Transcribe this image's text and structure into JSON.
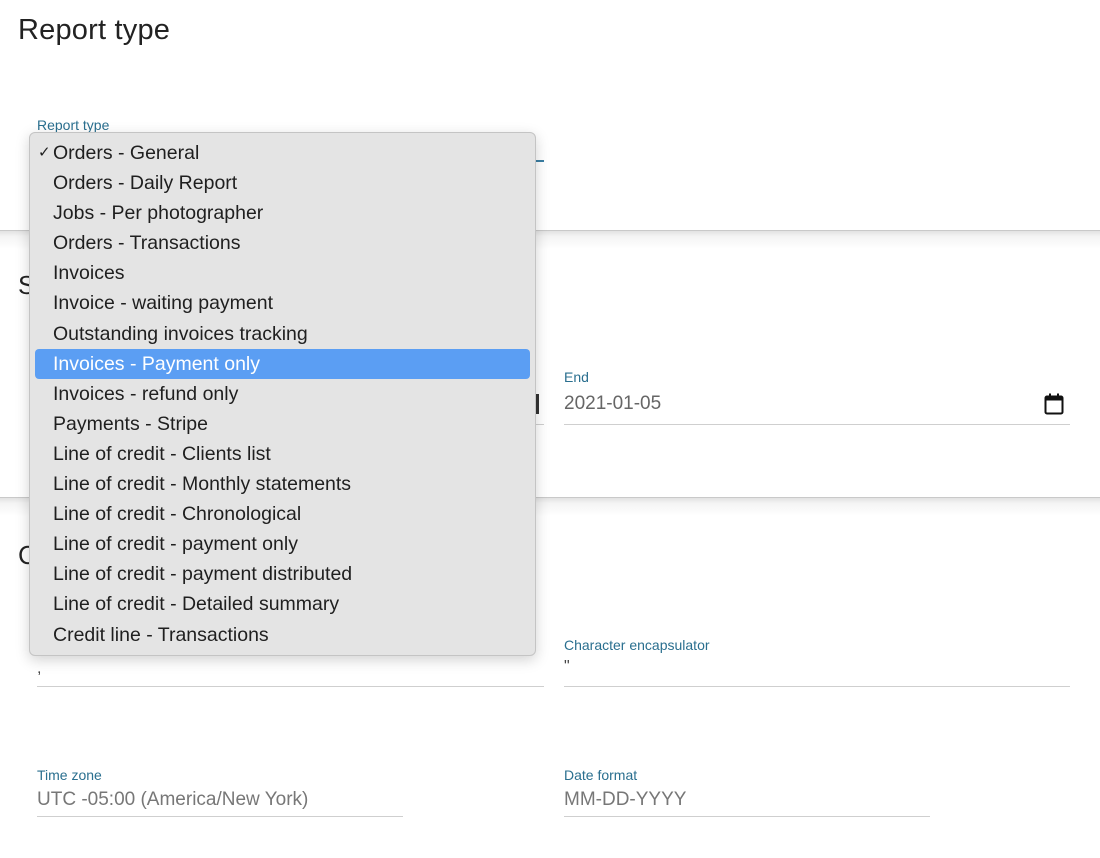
{
  "page_title": "Report type",
  "report_type": {
    "label": "Report type",
    "options": [
      "Orders - General",
      "Orders - Daily Report",
      "Jobs - Per photographer",
      "Orders - Transactions",
      "Invoices",
      "Invoice - waiting payment",
      "Outstanding invoices tracking",
      "Invoices - Payment only",
      "Invoices - refund only",
      "Payments - Stripe",
      "Line of credit - Clients list",
      "Line of credit - Monthly statements",
      "Line of credit - Chronological",
      "Line of credit - payment only",
      "Line of credit - payment distributed",
      "Line of credit - Detailed summary",
      "Credit line - Transactions"
    ],
    "checked_option": "Orders - General",
    "highlighted_option": "Invoices - Payment only",
    "check_mark": "✓"
  },
  "schedule_section": {
    "heading_partial": "S",
    "end": {
      "label": "End",
      "value": "2021-01-05",
      "icon": "calendar-icon"
    }
  },
  "options_section": {
    "heading_partial": "C",
    "separator": {
      "value": ","
    },
    "encapsulator": {
      "label": "Character encapsulator",
      "value": "\""
    },
    "time_zone": {
      "label": "Time zone",
      "value": "UTC -05:00 (America/New York)"
    },
    "date_format": {
      "label": "Date format",
      "value": "MM-DD-YYYY"
    }
  },
  "colors": {
    "accent": "#2a6f8f",
    "highlight": "#5b9ef3"
  }
}
